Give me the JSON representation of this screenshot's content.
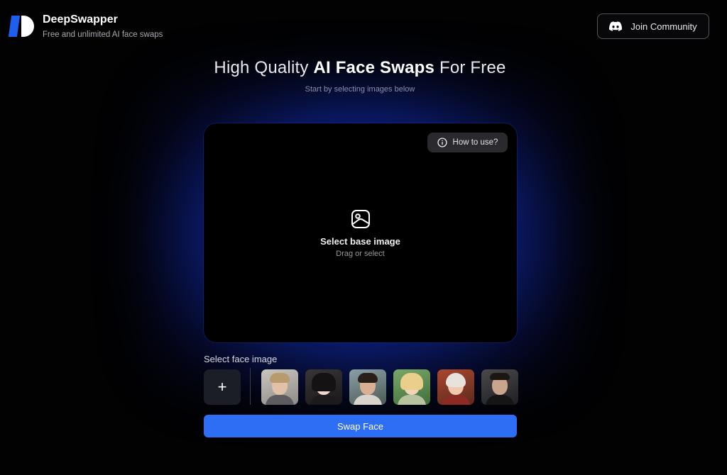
{
  "brand": {
    "name": "DeepSwapper",
    "tagline": "Free and unlimited AI face swaps"
  },
  "header": {
    "join_label": "Join Community"
  },
  "hero": {
    "title_prefix": "High Quality ",
    "title_bold": "AI Face Swaps",
    "title_suffix": " For Free",
    "subtitle": "Start by selecting images below"
  },
  "dropzone": {
    "howto_label": "How to use?",
    "title": "Select base image",
    "hint": "Drag or select"
  },
  "faces": {
    "label": "Select face image",
    "add_label": "+",
    "thumbnails": [
      {
        "name": "face-thumbnail-1"
      },
      {
        "name": "face-thumbnail-2"
      },
      {
        "name": "face-thumbnail-3"
      },
      {
        "name": "face-thumbnail-4"
      },
      {
        "name": "face-thumbnail-5"
      },
      {
        "name": "face-thumbnail-6"
      }
    ]
  },
  "actions": {
    "swap_label": "Swap Face"
  },
  "colors": {
    "accent": "#2e6ef5",
    "glow": "#1840dc",
    "background": "#020203"
  },
  "icons": {
    "join": "discord-icon",
    "howto": "info-icon",
    "dropzone": "image-icon",
    "add": "plus-icon"
  }
}
